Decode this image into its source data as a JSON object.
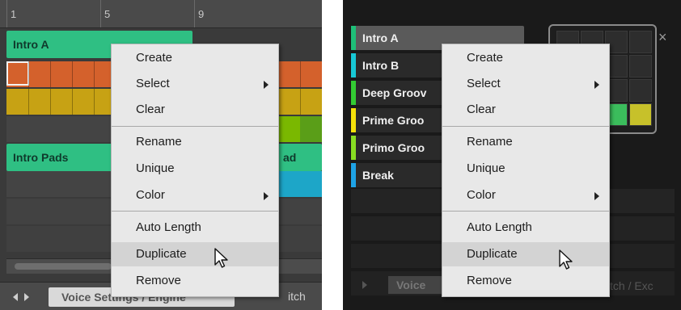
{
  "left_panel": {
    "ruler_labels": [
      "1",
      "5",
      "9"
    ],
    "clips": {
      "top": "Intro A",
      "middle": "Intro Pads",
      "middle_right": "ad"
    },
    "bottom_tab": "Voice Settings / Engine",
    "bottom_right_label": "itch",
    "colors": {
      "clip_green": "#2fbf83",
      "orange": "#d4612c",
      "yellow": "#c7a214",
      "accent_green": "#7ab800",
      "accent_cyan": "#1da6c8"
    }
  },
  "right_panel": {
    "slots": [
      {
        "label": "Intro A",
        "color": "#1ebf78"
      },
      {
        "label": "Intro B",
        "color": "#17c8d6"
      },
      {
        "label": "Deep Groov",
        "color": "#33cc33"
      },
      {
        "label": "Prime Groo",
        "color": "#f5e10a"
      },
      {
        "label": "Primo Groo",
        "color": "#88dd22"
      },
      {
        "label": "Break",
        "color": "#1ea3e6"
      }
    ],
    "close_label": "×",
    "pad_colors": {
      "green": "#3bbd5c",
      "yellow": "#c7c12a"
    },
    "bottom_tab_fragment": "Voice",
    "bottom_right_fragment": "tch / Exc"
  },
  "context_menu": {
    "groups": [
      [
        {
          "label": "Create"
        },
        {
          "label": "Select",
          "submenu": true
        },
        {
          "label": "Clear"
        }
      ],
      [
        {
          "label": "Rename"
        },
        {
          "label": "Unique"
        },
        {
          "label": "Color",
          "submenu": true
        }
      ],
      [
        {
          "label": "Auto Length"
        },
        {
          "label": "Duplicate",
          "highlighted": true
        },
        {
          "label": "Remove"
        }
      ]
    ]
  },
  "left_menu": {
    "items": [
      "Create",
      "Select",
      "Clear",
      "Rename",
      "Unique",
      "Color",
      "Auto Length",
      "Duplicate",
      "Remove"
    ]
  },
  "right_menu": {
    "items": [
      "Create",
      "Select",
      "Clear",
      "Rename",
      "Unique",
      "Color",
      "Auto Length",
      "Duplicate",
      "Remove"
    ]
  }
}
